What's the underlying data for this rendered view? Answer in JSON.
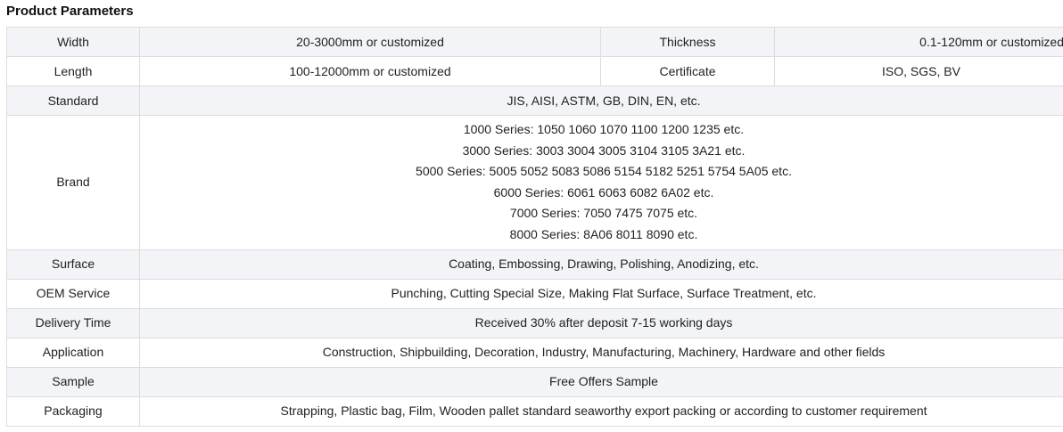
{
  "section_title": "Product Parameters",
  "rows": {
    "width": {
      "label": "Width",
      "value": "20-3000mm or customized",
      "label2": "Thickness",
      "value2": "0.1-120mm or customized"
    },
    "length": {
      "label": "Length",
      "value": "100-12000mm or customized",
      "label2": "Certificate",
      "value2": "ISO, SGS, BV"
    },
    "standard": {
      "label": "Standard",
      "value": "JIS, AISI, ASTM, GB, DIN, EN, etc."
    },
    "brand": {
      "label": "Brand",
      "lines": [
        "1000 Series: 1050 1060 1070 1100 1200 1235 etc.",
        "3000 Series: 3003 3004 3005 3104 3105 3A21 etc.",
        "5000 Series: 5005 5052 5083 5086 5154 5182 5251 5754 5A05 etc.",
        "6000 Series: 6061 6063 6082 6A02 etc.",
        "7000 Series: 7050 7475 7075 etc.",
        "8000 Series: 8A06 8011 8090 etc."
      ]
    },
    "surface": {
      "label": "Surface",
      "value": "Coating, Embossing, Drawing, Polishing, Anodizing, etc."
    },
    "oem": {
      "label": "OEM Service",
      "value": "Punching, Cutting Special Size, Making Flat Surface, Surface Treatment, etc."
    },
    "delivery": {
      "label": "Delivery Time",
      "value": "Received 30% after deposit 7-15 working days"
    },
    "application": {
      "label": "Application",
      "value": "Construction, Shipbuilding, Decoration, Industry, Manufacturing, Machinery, Hardware and other fields"
    },
    "sample": {
      "label": "Sample",
      "value": "Free Offers Sample"
    },
    "packaging": {
      "label": "Packaging",
      "value": "Strapping, Plastic bag, Film, Wooden pallet standard seaworthy export packing or according to customer requirement"
    }
  }
}
